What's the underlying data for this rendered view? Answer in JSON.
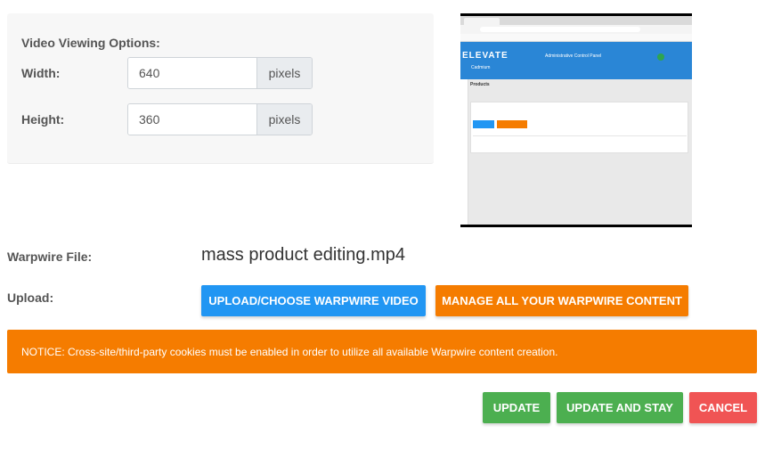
{
  "video_options": {
    "heading": "Video Viewing Options:",
    "width_label": "Width:",
    "width_value": "640",
    "width_unit": "pixels",
    "height_label": "Height:",
    "height_value": "360",
    "height_unit": "pixels"
  },
  "thumbnail": {
    "brand": "ELEVATE",
    "sub_brand": "Cadmium",
    "panel_title": "Administrative Control Panel",
    "section": "Products"
  },
  "warpwire": {
    "file_label": "Warpwire File:",
    "file_name": "mass product editing.mp4",
    "upload_label": "Upload:",
    "upload_button": "UPLOAD/CHOOSE WARPWIRE VIDEO",
    "manage_button": "MANAGE ALL YOUR WARPWIRE CONTENT"
  },
  "notice": {
    "text": "NOTICE: Cross-site/third-party cookies must be enabled in order to utilize all available Warpwire content creation."
  },
  "actions": {
    "update": "UPDATE",
    "update_and_stay": "UPDATE AND STAY",
    "cancel": "CANCEL"
  },
  "colors": {
    "primary_blue": "#2196f3",
    "warning_orange": "#f57c00",
    "success_green": "#4caf50",
    "danger_red": "#f05454"
  }
}
